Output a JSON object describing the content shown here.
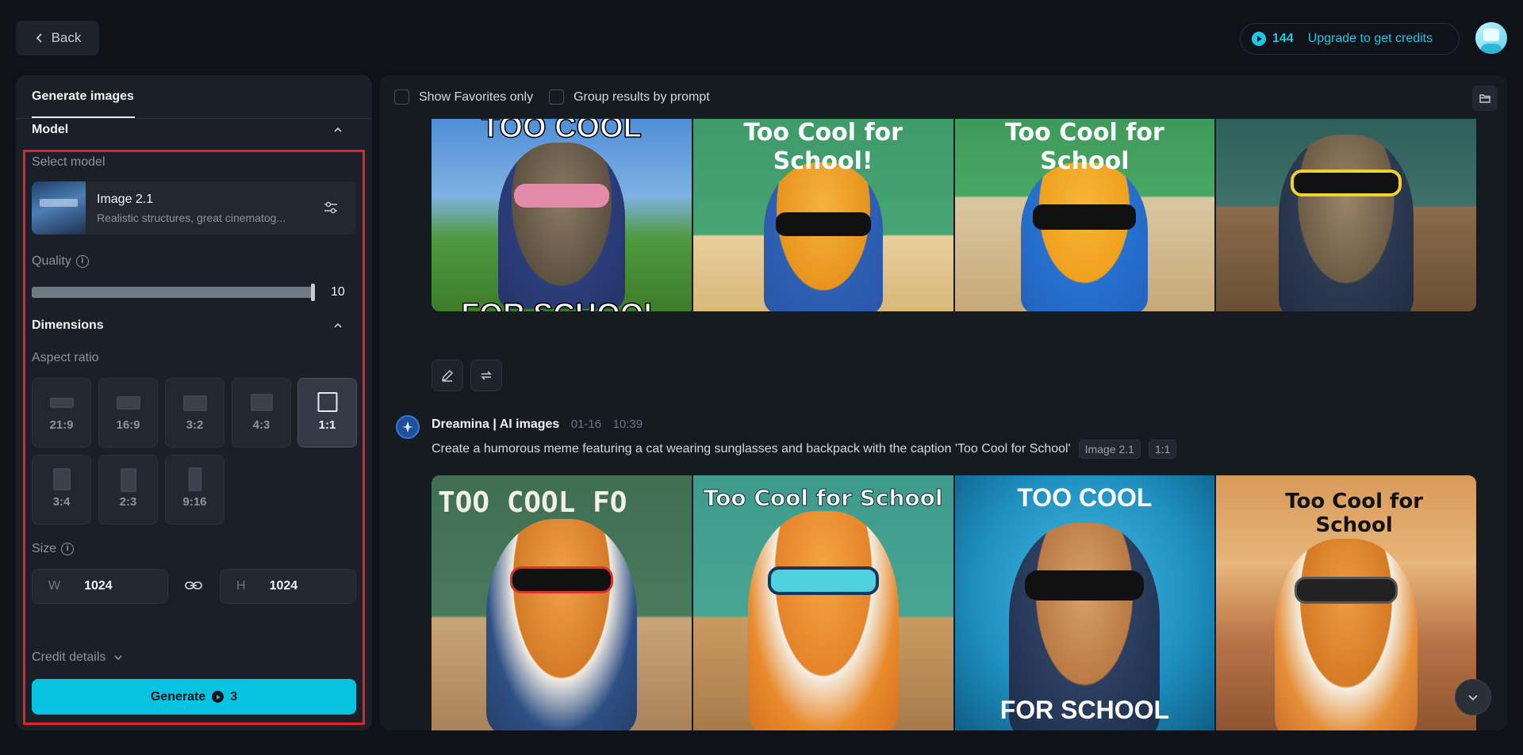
{
  "header": {
    "back_label": "Back",
    "credit_count": "144",
    "upgrade_label": "Upgrade to get credits"
  },
  "left_panel": {
    "tab_label": "Generate images",
    "model_section": "Model",
    "select_model_label": "Select model",
    "model": {
      "name": "Image 2.1",
      "description": "Realistic structures, great cinematog..."
    },
    "quality_label": "Quality",
    "quality_value": "10",
    "quality_level": 1.0,
    "dimensions_section": "Dimensions",
    "aspect_ratio_label": "Aspect ratio",
    "aspect_ratios": [
      "21:9",
      "16:9",
      "3:2",
      "4:3",
      "1:1",
      "3:4",
      "2:3",
      "9:16"
    ],
    "selected_ratio": "1:1",
    "size_label": "Size",
    "width_prefix": "W",
    "width_value": "1024",
    "height_prefix": "H",
    "height_value": "1024",
    "credit_details_label": "Credit details",
    "generate_label": "Generate",
    "generate_cost": "3",
    "highlight_color": "#e3232b",
    "accent_color": "#08c3df"
  },
  "right_panel": {
    "filters": {
      "favorites_label": "Show Favorites only",
      "group_label": "Group results by prompt"
    },
    "top_captions": [
      {
        "top": "TOO COOL",
        "bottom": "FOR SCHOOL"
      },
      {
        "top": "Too Cool for School!",
        "bottom": ""
      },
      {
        "top": "Too Cool for School",
        "bottom": ""
      },
      {
        "top": "",
        "bottom": ""
      }
    ],
    "result": {
      "bot_name": "Dreamina | AI images",
      "date": "01-16",
      "time": "10:39",
      "prompt": "Create a humorous meme featuring a cat wearing sunglasses and backpack with the caption 'Too Cool for School'",
      "model_tag": "Image 2.1",
      "ratio_tag": "1:1"
    },
    "bottom_captions": [
      {
        "top": "TOO COOL FO",
        "bottom": ""
      },
      {
        "top": "Too Cool for School",
        "bottom": ""
      },
      {
        "top": "TOO COOL",
        "bottom": "FOR SCHOOL"
      },
      {
        "top": "Too Cool for School",
        "bottom": ""
      }
    ]
  }
}
